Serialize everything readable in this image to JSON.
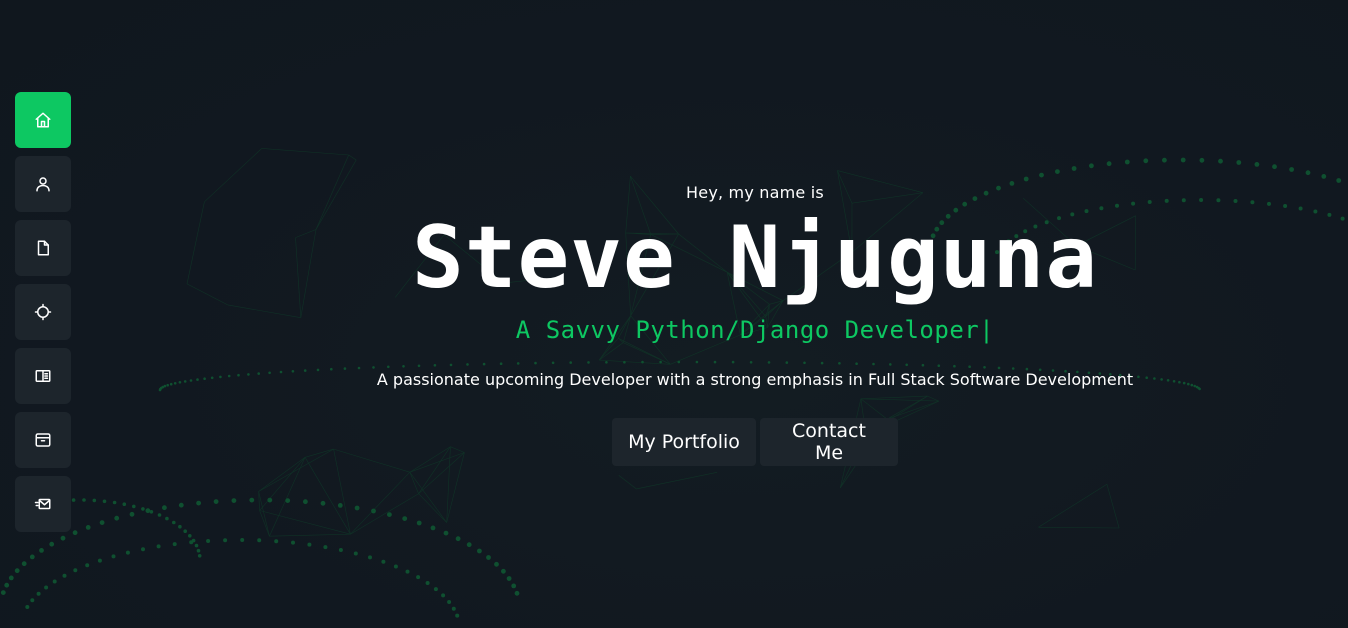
{
  "sidebar": {
    "items": [
      {
        "name": "home",
        "icon": "home-icon",
        "active": true
      },
      {
        "name": "about",
        "icon": "user-icon",
        "active": false
      },
      {
        "name": "resume",
        "icon": "file-icon",
        "active": false
      },
      {
        "name": "services",
        "icon": "gear-icon",
        "active": false
      },
      {
        "name": "portfolio",
        "icon": "book-icon",
        "active": false
      },
      {
        "name": "blog",
        "icon": "archive-icon",
        "active": false
      },
      {
        "name": "contact",
        "icon": "mail-send-icon",
        "active": false
      }
    ]
  },
  "hero": {
    "greeting": "Hey, my name is",
    "name": "Steve Njuguna",
    "role": "A Savvy Python/Django Developer",
    "cursor": "|",
    "tagline": "A passionate upcoming Developer with a strong emphasis in Full Stack Software Development",
    "buttons": {
      "portfolio": "My Portfolio",
      "contact": "Contact Me"
    }
  },
  "colors": {
    "accent": "#0dc862",
    "background": "#111820",
    "button": "#1d252c"
  }
}
